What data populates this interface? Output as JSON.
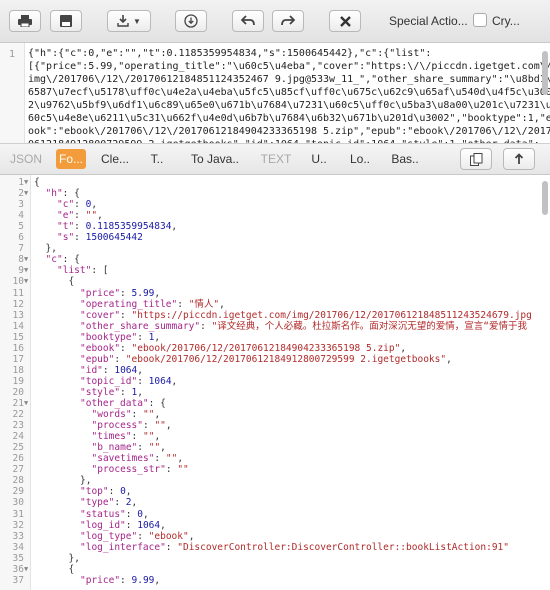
{
  "toolbar": {
    "special_actions_label": "Special Actio...",
    "copy_label": "Cry...",
    "colors": {
      "accent": "#f39c3c"
    }
  },
  "raw": {
    "line_number": "1",
    "text": "{\"h\":{\"c\":0,\"e\":\"\",\"t\":0.1185359954834,\"s\":1500645442},\"c\":{\"list\":\n[{\"price\":5.99,\"operating_title\":\"\\u60c5\\u4eba\",\"cover\":\"https:\\/\\/piccdn.igetget.com\\/\nimg\\/201706\\/12\\/20170612184851124352467 9.jpg@533w_11_\",\"other_share_summary\":\"\\u8bd1\\u\n6587\\u7ecf\\u5178\\uff0c\\u4e2a\\u4eba\\u5fc5\\u85cf\\uff0c\\u675c\\u62c9\\u65af\\u540d\\u4f5c\\u300\n2\\u9762\\u5bf9\\u6df1\\u6c89\\u65e0\\u671b\\u7684\\u7231\\u60c5\\uff0c\\u5ba3\\u8a00\\u201c\\u7231\\u\n60c5\\u4e8e\\u6211\\u5c31\\u662f\\u4e0d\\u6b7b\\u7684\\u6b32\\u671b\\u201d\\u3002\",\"booktype\":1,\"eb\nook\":\"ebook\\/201706\\/12\\/20170612184904233365198 5.zip\",\"epub\":\"ebook\\/201706\\/12\\/2017\n0612184912800729599 2.igetgetbooks\",\"id\":1064,\"topic_id\":1064,\"style\":1,\"other_data\":\n{\"words\":\"\",\"process\":\"\",\"times\":\"\",\"b_name\":\"\",\"savetimes\":\"\",\"process_str\":\"\"},\"top\":"
  },
  "tabs": [
    {
      "label": "JSON",
      "state": "disabled"
    },
    {
      "label": "Fo...",
      "state": "active"
    },
    {
      "label": "Cle...",
      "state": "normal"
    },
    {
      "label": "T..",
      "state": "normal"
    },
    {
      "label": "To Java..",
      "state": "normal"
    },
    {
      "label": "TEXT",
      "state": "disabled"
    },
    {
      "label": "U..",
      "state": "normal"
    },
    {
      "label": "Lo..",
      "state": "normal"
    },
    {
      "label": "Bas..",
      "state": "normal"
    }
  ],
  "tree_lines": [
    {
      "n": "1",
      "f": "▼",
      "i": 0,
      "t": [
        [
          "p",
          "{"
        ]
      ]
    },
    {
      "n": "2",
      "f": "▼",
      "i": 1,
      "t": [
        [
          "k",
          "\"h\""
        ],
        [
          "p",
          ": {"
        ]
      ]
    },
    {
      "n": "3",
      "f": "",
      "i": 2,
      "t": [
        [
          "k",
          "\"c\""
        ],
        [
          "p",
          ": "
        ],
        [
          "n",
          "0"
        ],
        [
          "p",
          ","
        ]
      ]
    },
    {
      "n": "4",
      "f": "",
      "i": 2,
      "t": [
        [
          "k",
          "\"e\""
        ],
        [
          "p",
          ": "
        ],
        [
          "s",
          "\"\""
        ],
        [
          "p",
          ","
        ]
      ]
    },
    {
      "n": "5",
      "f": "",
      "i": 2,
      "t": [
        [
          "k",
          "\"t\""
        ],
        [
          "p",
          ": "
        ],
        [
          "n",
          "0.1185359954834"
        ],
        [
          "p",
          ","
        ]
      ]
    },
    {
      "n": "6",
      "f": "",
      "i": 2,
      "t": [
        [
          "k",
          "\"s\""
        ],
        [
          "p",
          ": "
        ],
        [
          "n",
          "1500645442"
        ]
      ]
    },
    {
      "n": "7",
      "f": "",
      "i": 1,
      "t": [
        [
          "p",
          "},"
        ]
      ]
    },
    {
      "n": "8",
      "f": "▼",
      "i": 1,
      "t": [
        [
          "k",
          "\"c\""
        ],
        [
          "p",
          ": {"
        ]
      ]
    },
    {
      "n": "9",
      "f": "▼",
      "i": 2,
      "t": [
        [
          "k",
          "\"list\""
        ],
        [
          "p",
          ": ["
        ]
      ]
    },
    {
      "n": "10",
      "f": "▼",
      "i": 3,
      "t": [
        [
          "p",
          "{"
        ]
      ]
    },
    {
      "n": "11",
      "f": "",
      "i": 4,
      "t": [
        [
          "k",
          "\"price\""
        ],
        [
          "p",
          ": "
        ],
        [
          "n",
          "5.99"
        ],
        [
          "p",
          ","
        ]
      ]
    },
    {
      "n": "12",
      "f": "",
      "i": 4,
      "t": [
        [
          "k",
          "\"operating_title\""
        ],
        [
          "p",
          ": "
        ],
        [
          "s",
          "\"情人\""
        ],
        [
          "p",
          ","
        ]
      ]
    },
    {
      "n": "13",
      "f": "",
      "i": 4,
      "t": [
        [
          "k",
          "\"cover\""
        ],
        [
          "p",
          ": "
        ],
        [
          "s",
          "\"https://piccdn.igetget.com/img/201706/12/201706121848511243524679.jpg"
        ]
      ]
    },
    {
      "n": "14",
      "f": "",
      "i": 4,
      "t": [
        [
          "k",
          "\"other_share_summary\""
        ],
        [
          "p",
          ": "
        ],
        [
          "s",
          "\"译文经典，个人必藏。杜拉斯名作。面对深沉无望的爱情，宣言“爱情于我"
        ]
      ]
    },
    {
      "n": "15",
      "f": "",
      "i": 4,
      "t": [
        [
          "k",
          "\"booktype\""
        ],
        [
          "p",
          ": "
        ],
        [
          "n",
          "1"
        ],
        [
          "p",
          ","
        ]
      ]
    },
    {
      "n": "16",
      "f": "",
      "i": 4,
      "t": [
        [
          "k",
          "\"ebook\""
        ],
        [
          "p",
          ": "
        ],
        [
          "s",
          "\"ebook/201706/12/20170612184904233365198 5.zip\""
        ],
        [
          "p",
          ","
        ]
      ]
    },
    {
      "n": "17",
      "f": "",
      "i": 4,
      "t": [
        [
          "k",
          "\"epub\""
        ],
        [
          "p",
          ": "
        ],
        [
          "s",
          "\"ebook/201706/12/20170612184912800729599 2.igetgetbooks\""
        ],
        [
          "p",
          ","
        ]
      ]
    },
    {
      "n": "18",
      "f": "",
      "i": 4,
      "t": [
        [
          "k",
          "\"id\""
        ],
        [
          "p",
          ": "
        ],
        [
          "n",
          "1064"
        ],
        [
          "p",
          ","
        ]
      ]
    },
    {
      "n": "19",
      "f": "",
      "i": 4,
      "t": [
        [
          "k",
          "\"topic_id\""
        ],
        [
          "p",
          ": "
        ],
        [
          "n",
          "1064"
        ],
        [
          "p",
          ","
        ]
      ]
    },
    {
      "n": "20",
      "f": "",
      "i": 4,
      "t": [
        [
          "k",
          "\"style\""
        ],
        [
          "p",
          ": "
        ],
        [
          "n",
          "1"
        ],
        [
          "p",
          ","
        ]
      ]
    },
    {
      "n": "21",
      "f": "▼",
      "i": 4,
      "t": [
        [
          "k",
          "\"other_data\""
        ],
        [
          "p",
          ": {"
        ]
      ]
    },
    {
      "n": "22",
      "f": "",
      "i": 5,
      "t": [
        [
          "k",
          "\"words\""
        ],
        [
          "p",
          ": "
        ],
        [
          "s",
          "\"\""
        ],
        [
          "p",
          ","
        ]
      ]
    },
    {
      "n": "23",
      "f": "",
      "i": 5,
      "t": [
        [
          "k",
          "\"process\""
        ],
        [
          "p",
          ": "
        ],
        [
          "s",
          "\"\""
        ],
        [
          "p",
          ","
        ]
      ]
    },
    {
      "n": "24",
      "f": "",
      "i": 5,
      "t": [
        [
          "k",
          "\"times\""
        ],
        [
          "p",
          ": "
        ],
        [
          "s",
          "\"\""
        ],
        [
          "p",
          ","
        ]
      ]
    },
    {
      "n": "25",
      "f": "",
      "i": 5,
      "t": [
        [
          "k",
          "\"b_name\""
        ],
        [
          "p",
          ": "
        ],
        [
          "s",
          "\"\""
        ],
        [
          "p",
          ","
        ]
      ]
    },
    {
      "n": "26",
      "f": "",
      "i": 5,
      "t": [
        [
          "k",
          "\"savetimes\""
        ],
        [
          "p",
          ": "
        ],
        [
          "s",
          "\"\""
        ],
        [
          "p",
          ","
        ]
      ]
    },
    {
      "n": "27",
      "f": "",
      "i": 5,
      "t": [
        [
          "k",
          "\"process_str\""
        ],
        [
          "p",
          ": "
        ],
        [
          "s",
          "\"\""
        ]
      ]
    },
    {
      "n": "28",
      "f": "",
      "i": 4,
      "t": [
        [
          "p",
          "},"
        ]
      ]
    },
    {
      "n": "29",
      "f": "",
      "i": 4,
      "t": [
        [
          "k",
          "\"top\""
        ],
        [
          "p",
          ": "
        ],
        [
          "n",
          "0"
        ],
        [
          "p",
          ","
        ]
      ]
    },
    {
      "n": "30",
      "f": "",
      "i": 4,
      "t": [
        [
          "k",
          "\"type\""
        ],
        [
          "p",
          ": "
        ],
        [
          "n",
          "2"
        ],
        [
          "p",
          ","
        ]
      ]
    },
    {
      "n": "31",
      "f": "",
      "i": 4,
      "t": [
        [
          "k",
          "\"status\""
        ],
        [
          "p",
          ": "
        ],
        [
          "n",
          "0"
        ],
        [
          "p",
          ","
        ]
      ]
    },
    {
      "n": "32",
      "f": "",
      "i": 4,
      "t": [
        [
          "k",
          "\"log_id\""
        ],
        [
          "p",
          ": "
        ],
        [
          "n",
          "1064"
        ],
        [
          "p",
          ","
        ]
      ]
    },
    {
      "n": "33",
      "f": "",
      "i": 4,
      "t": [
        [
          "k",
          "\"log_type\""
        ],
        [
          "p",
          ": "
        ],
        [
          "s",
          "\"ebook\""
        ],
        [
          "p",
          ","
        ]
      ]
    },
    {
      "n": "34",
      "f": "",
      "i": 4,
      "t": [
        [
          "k",
          "\"log_interface\""
        ],
        [
          "p",
          ": "
        ],
        [
          "s",
          "\"DiscoverController:DiscoverController::bookListAction:91\""
        ]
      ]
    },
    {
      "n": "35",
      "f": "",
      "i": 3,
      "t": [
        [
          "p",
          "},"
        ]
      ]
    },
    {
      "n": "36",
      "f": "▼",
      "i": 3,
      "t": [
        [
          "p",
          "{"
        ]
      ]
    },
    {
      "n": "37",
      "f": "",
      "i": 4,
      "t": [
        [
          "k",
          "\"price\""
        ],
        [
          "p",
          ": "
        ],
        [
          "n",
          "9.99"
        ],
        [
          "p",
          ","
        ]
      ]
    }
  ]
}
